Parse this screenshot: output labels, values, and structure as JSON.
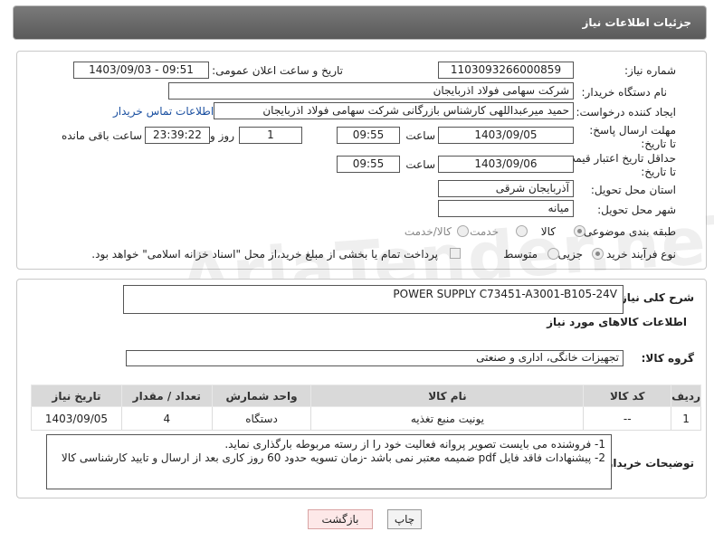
{
  "header": {
    "title": "جزئیات اطلاعات نیاز"
  },
  "form": {
    "need_number_label": "شماره نیاز:",
    "need_number": "1103093266000859",
    "announce_label": "تاریخ و ساعت اعلان عمومی:",
    "announce_value": "1403/09/03 - 09:51",
    "buyer_org_label": "نام دستگاه خریدار:",
    "buyer_org": "شرکت سهامی فولاد اذربایجان",
    "creator_label": "ایجاد کننده درخواست:",
    "creator": "حمید میرعبداللهی کارشناس بازرگانی شرکت سهامی فولاد اذربایجان",
    "contact_link": "اطلاعات تماس خریدار",
    "deadline_label": "مهلت ارسال پاسخ: تا تاریخ:",
    "deadline_date": "1403/09/05",
    "time_label": "ساعت",
    "deadline_time": "09:55",
    "days": "1",
    "days_label": "روز و",
    "remaining": "23:39:22",
    "remaining_label": "ساعت باقی مانده",
    "validity_label": "حداقل تاریخ اعتبار قیمت: تا تاریخ:",
    "validity_date": "1403/09/06",
    "validity_time": "09:55",
    "province_label": "استان محل تحویل:",
    "province": "آذربایجان شرقی",
    "city_label": "شهر محل تحویل:",
    "city": "میانه",
    "category_label": "طبقه بندی موضوعی:",
    "category_options": [
      "کالا",
      "خدمت",
      "کالا/خدمت"
    ],
    "purchase_label": "نوع فرآیند خرید :",
    "purchase_options": [
      "جزیی",
      "متوسط"
    ],
    "payment_note": "پرداخت تمام یا بخشی از مبلغ خرید،از محل \"اسناد خزانه اسلامی\" خواهد بود."
  },
  "details": {
    "summary_label": "شرح کلی نیاز:",
    "summary": "POWER SUPPLY C73451-A3001-B105-24V",
    "goods_info_title": "اطلاعات کالاهای مورد نیاز",
    "group_label": "گروه کالا:",
    "group": "تجهیزات خانگی، اداری و صنعتی",
    "table": {
      "headers": [
        "ردیف",
        "کد کالا",
        "نام کالا",
        "واحد شمارش",
        "تعداد / مقدار",
        "تاریخ نیاز"
      ],
      "rows": [
        [
          "1",
          "--",
          "یونیت منبع تغذیه",
          "دستگاه",
          "4",
          "1403/09/05"
        ]
      ]
    },
    "buyer_notes_label": "توضیحات خریدار:",
    "buyer_notes_1": "1- فروشنده می بایست تصویر پروانه فعالیت خود را از رسته مربوطه بارگذاری نماید.",
    "buyer_notes_2": "2- پیشنهادات فاقد فایل pdf  ضمیمه معتبر نمی باشد -زمان تسویه حدود 60  روز کاری بعد از ارسال و تایید کارشناسی کالا"
  },
  "buttons": {
    "print": "چاپ",
    "back": "بازگشت"
  },
  "watermark": "AriaTender.neT"
}
